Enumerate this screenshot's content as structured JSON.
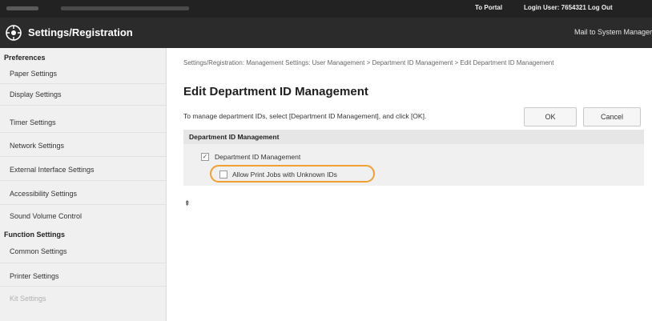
{
  "topbar": {
    "portal_label": "To Portal",
    "login_user": "Login User:  7654321  Log Out"
  },
  "titlebar": {
    "title": "Settings/Registration",
    "mail": "Mail to System Manager"
  },
  "sidebar": {
    "sections": [
      {
        "label": "Preferences"
      },
      {
        "label": "Function Settings"
      }
    ],
    "preferences_items": [
      "Paper Settings",
      "Display Settings",
      "Timer Settings",
      "Network Settings",
      "External Interface Settings",
      "Accessibility Settings",
      "Sound Volume Control"
    ],
    "function_items": [
      "Common Settings",
      "Printer Settings",
      "Kit Settings"
    ]
  },
  "main": {
    "breadcrumb": "Settings/Registration: Management Settings: User Management > Department ID Management > Edit Department ID Management",
    "heading": "Edit Department ID Management",
    "instruction": "To manage department IDs, select [Department ID Management], and click [OK].",
    "ok_label": "OK",
    "cancel_label": "Cancel",
    "section_title": "Department ID Management",
    "option1": {
      "label": "Department ID Management",
      "checked": true,
      "mark": "✓"
    },
    "option2": {
      "label": "Allow Print Jobs with Unknown IDs",
      "checked": false
    },
    "highlight_color": "#f0a030",
    "to_top_glyph": "⇞"
  }
}
